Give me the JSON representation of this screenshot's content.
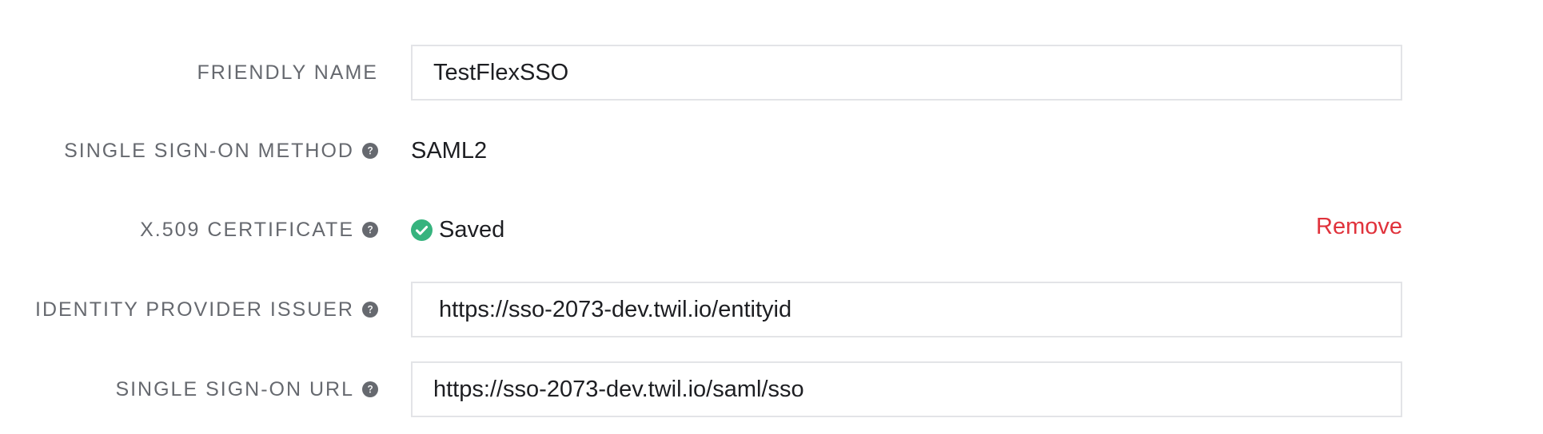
{
  "sso_form": {
    "friendly_name": {
      "label": "FRIENDLY NAME",
      "value": "TestFlexSSO"
    },
    "sso_method": {
      "label": "SINGLE SIGN-ON METHOD",
      "value": "SAML2"
    },
    "certificate": {
      "label": "X.509 CERTIFICATE",
      "status": "Saved",
      "remove_label": "Remove"
    },
    "idp_issuer": {
      "label": "IDENTITY PROVIDER ISSUER",
      "value": "https://sso-2073-dev.twil.io/entityid"
    },
    "sso_url": {
      "label": "SINGLE SIGN-ON URL",
      "value": "https://sso-2073-dev.twil.io/saml/sso"
    }
  },
  "icons": {
    "help": "question-circle-icon",
    "status": "check-circle-icon"
  },
  "colors": {
    "label": "#66696f",
    "text": "#1d1e22",
    "input_border": "#e3e4e7",
    "success": "#36b37e",
    "danger": "#e0323b"
  }
}
